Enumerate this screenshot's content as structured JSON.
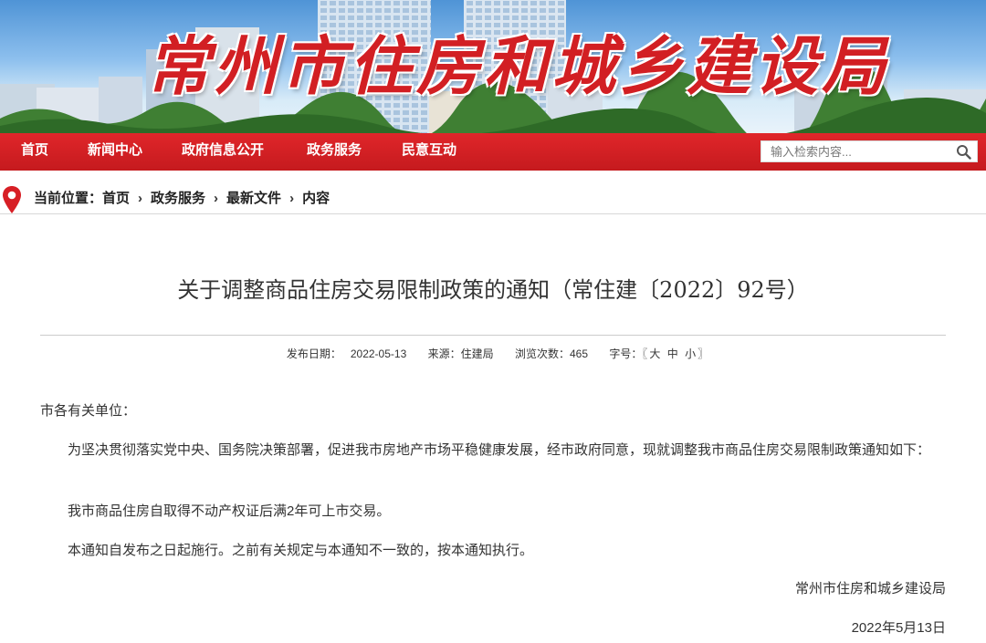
{
  "banner": {
    "title": "常州市住房和城乡建设局"
  },
  "nav": {
    "items": [
      {
        "label": "首页"
      },
      {
        "label": "新闻中心"
      },
      {
        "label": "政府信息公开"
      },
      {
        "label": "政务服务"
      },
      {
        "label": "民意互动"
      }
    ],
    "search_placeholder": "输入检索内容..."
  },
  "breadcrumb": {
    "prefix": "当前位置：",
    "items": [
      "首页",
      "政务服务",
      "最新文件",
      "内容"
    ]
  },
  "article": {
    "title": "关于调整商品住房交易限制政策的通知（常住建〔2022〕92号）",
    "meta": {
      "date_label": "发布日期：",
      "date": "2022-05-13",
      "source_label": "来源：",
      "source": "住建局",
      "views_label": "浏览次数：",
      "views": "465",
      "font_label": "字号：",
      "font_open": "〖",
      "font_large": "大",
      "font_medium": "中",
      "font_small": "小",
      "font_close": "〗"
    },
    "salutation": "市各有关单位：",
    "paragraphs": [
      "为坚决贯彻落实党中央、国务院决策部署，促进我市房地产市场平稳健康发展，经市政府同意，现就调整我市商品住房交易限制政策通知如下：",
      "我市商品住房自取得不动产权证后满2年可上市交易。",
      "本通知自发布之日起施行。之前有关规定与本通知不一致的，按本通知执行。"
    ],
    "signature": "常州市住房和城乡建设局",
    "sign_date": "2022年5月13日"
  },
  "colors": {
    "nav_red": "#d21f23",
    "title_red": "#d21f23"
  }
}
